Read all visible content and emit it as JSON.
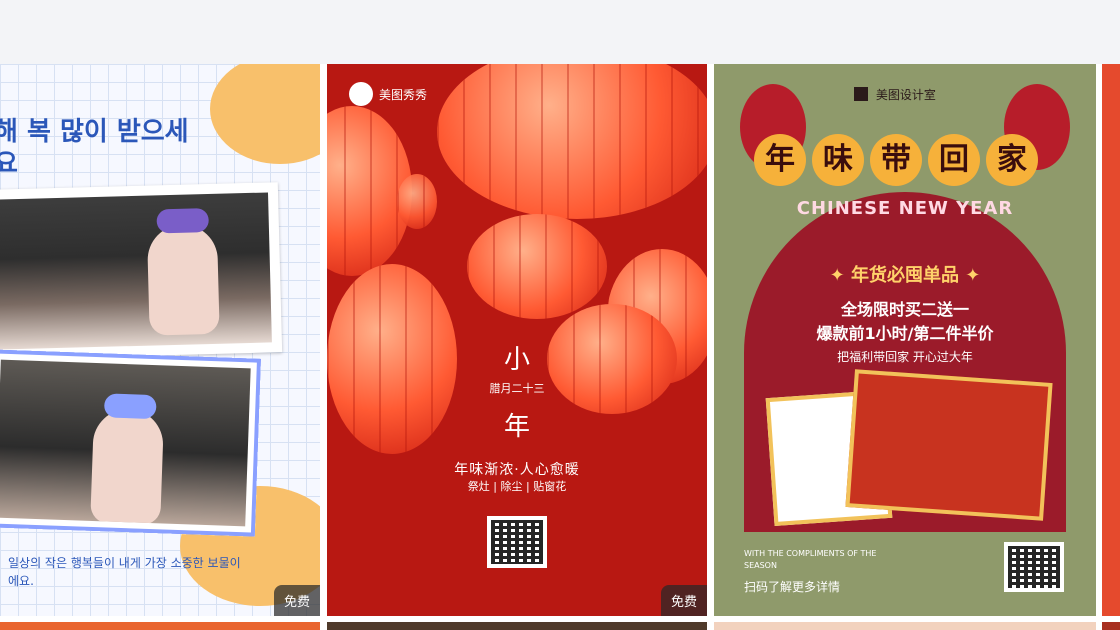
{
  "cards": [
    {
      "badge": "免费",
      "title": "해 복 많이 받으세요",
      "footer": "일상의 작은 행복들이 내게 가장 소중한 보물이에요."
    },
    {
      "badge": "免费",
      "brand": "美图秀秀",
      "big1": "小",
      "date": "腊月二十三",
      "big2": "年",
      "slogan": "年味渐浓·人心愈暖",
      "tags": "祭灶 | 除尘 | 贴窗花"
    },
    {
      "brand": "美图设计室",
      "banner": [
        "年",
        "味",
        "带",
        "回",
        "家"
      ],
      "en": "CHINESE NEW YEAR",
      "headline": "✦ 年货必囤单品 ✦",
      "line1": "全场限时买二送一",
      "line2": "爆款前1小时/第二件半价",
      "line3": "把福利带回家 开心过大年",
      "compliments": "WITH THE COMPLIMENTS OF THE SEASON",
      "scan": "扫码了解更多详情"
    }
  ],
  "colors": {
    "bg_top": "#f3f4f7",
    "card1_blue": "#2b57b9",
    "card2_red": "#b81812",
    "card3_green": "#8f9a6b",
    "card3_maroon": "#9b1b2a",
    "gold": "#f6b13a"
  }
}
